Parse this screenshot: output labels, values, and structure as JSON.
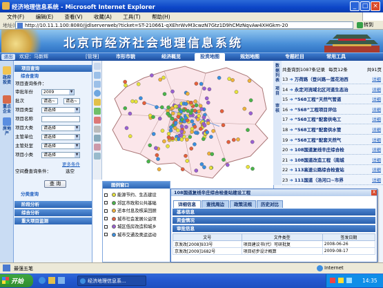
{
  "window": {
    "title": "经济地理信息系统 - Microsoft Internet Explorer"
  },
  "menu": [
    "文件(F)",
    "编辑(E)",
    "查看(V)",
    "收藏(A)",
    "工具(T)",
    "帮助(H)"
  ],
  "address": {
    "label": "地址(D)",
    "url": "http://10.11.1.100:8080/jjdlserverweb/?ticket=ST-210661-qXEhrWvM3cwzN7Gtz1D9hCMzNqvAw4XHGkm-20",
    "go": "转到"
  },
  "banner": {
    "title": "北京市经济社会地理信息系统"
  },
  "nav": {
    "exit": "退出",
    "user": "欢迎：马新辉",
    "admin": "[管理]",
    "tabs": [
      "市形市貌",
      "经济概览",
      "投资地图",
      "规划地图",
      "专题栏目",
      "常用工具"
    ],
    "active_tab": "投资地图"
  },
  "left_strip": [
    "政府投资",
    "重点企业",
    "房地产"
  ],
  "query": {
    "section": "项目查询",
    "sub": "综合查询",
    "cond_label": "项目查询条件：",
    "fields": [
      {
        "label": "审批年份",
        "value": "2009"
      },
      {
        "label": "批次",
        "value": "请选~",
        "value2": "请选~"
      },
      {
        "label": "项目类型",
        "value": "请选择"
      },
      {
        "label": "项目名称",
        "value": ""
      },
      {
        "label": "项目大类",
        "value": "请选择"
      },
      {
        "label": "主管单位",
        "value": "请选择"
      },
      {
        "label": "主管处室",
        "value": "请选择"
      },
      {
        "label": "项目小类",
        "value": "请选择"
      }
    ],
    "more": "更多条件",
    "spatial": "空间叠查询条件：",
    "spatial_sel": "选空",
    "button": "查 询",
    "cat_query": "分类查询",
    "bottom_sections": [
      "阶段分析",
      "综合分析",
      "重大项目监测"
    ]
  },
  "legend": {
    "title": "图例窗口",
    "items": [
      {
        "label": "能源节约、生态建设",
        "color": "#e7e33a"
      },
      {
        "label": "郊区市政和公共基础",
        "color": "#49b449"
      },
      {
        "label": "还本付息及核采回顾",
        "color": "#f0b23a"
      },
      {
        "label": "城市社会发展公益项",
        "color": "#e55f3b"
      },
      {
        "label": "城区低房改造和城乡",
        "color": "#9a5fd3"
      },
      {
        "label": "城市交通及奥运运动",
        "color": "#3a8fe0"
      }
    ]
  },
  "results": {
    "side_tabs": [
      "数据列表",
      "项目",
      "审核"
    ],
    "summary": "共查询到1087条记录",
    "per_page": "每页12条",
    "total": "共91页",
    "detail_link": "详细",
    "items": [
      {
        "no": "13",
        "title": "万荷路（登兴路—莲花池西"
      },
      {
        "no": "14",
        "title": "永定河流域北区河道生态治"
      },
      {
        "no": "15",
        "title": "“568工程”天然气管道"
      },
      {
        "no": "16",
        "title": "“568”工程项目评估"
      },
      {
        "no": "17",
        "title": "“568工程”配套供电工"
      },
      {
        "no": "18",
        "title": "“568工程”配套供水管"
      },
      {
        "no": "19",
        "title": "“568工程”配套天然气"
      },
      {
        "no": "20",
        "title": "108国道复线辛庄综合检"
      },
      {
        "no": "21",
        "title": "108国道改造工程（南城"
      },
      {
        "no": "22",
        "title": "113高速公路综合检查站"
      },
      {
        "no": "23",
        "title": "111国道（汤河口~市界"
      }
    ]
  },
  "detail": {
    "title": "108国道复线辛庄综合检查站建设工程",
    "close": "X",
    "tabs": [
      "详细信息",
      "查找周边",
      "政策法规",
      "历史对比"
    ],
    "sections": [
      "基本信息",
      "资金情况",
      "审批信息"
    ],
    "table": {
      "headers": [
        "文号",
        "文件类型",
        "签发日期"
      ],
      "rows": [
        [
          "京发改[2008]933号",
          "项目建议书(代）可研批复",
          "2008-06-26"
        ],
        [
          "京发改[2009]1682号",
          "项目初步设计概算",
          "2009-08-17"
        ]
      ]
    }
  },
  "status": {
    "text": "最强五笔",
    "zone": "Internet"
  },
  "taskbar": {
    "start": "开始",
    "task": "经济地理信息系...",
    "clock": "14:35"
  }
}
